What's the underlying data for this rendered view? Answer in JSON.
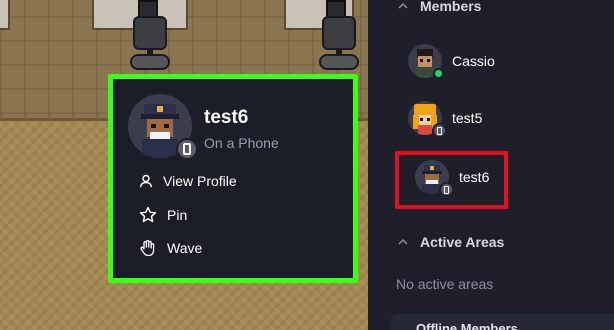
{
  "popup": {
    "user_name": "test6",
    "status": "On a Phone",
    "menu": [
      {
        "label": "View Profile",
        "icon": "person-icon"
      },
      {
        "label": "Pin",
        "icon": "star-icon"
      },
      {
        "label": "Wave",
        "icon": "hand-icon"
      }
    ]
  },
  "sidebar": {
    "members_heading": "Members",
    "members": [
      {
        "name": "Cassio",
        "status": "online"
      },
      {
        "name": "test5",
        "status": "phone"
      },
      {
        "name": "test6",
        "status": "phone"
      }
    ],
    "active_areas_heading": "Active Areas",
    "active_areas_empty": "No active areas",
    "offline_heading": "Offline Members"
  },
  "colors": {
    "popup_highlight": "#39ff14",
    "member_highlight": "#e0101e",
    "online": "#19d37a",
    "sidebar_bg": "#1e1f2b"
  }
}
